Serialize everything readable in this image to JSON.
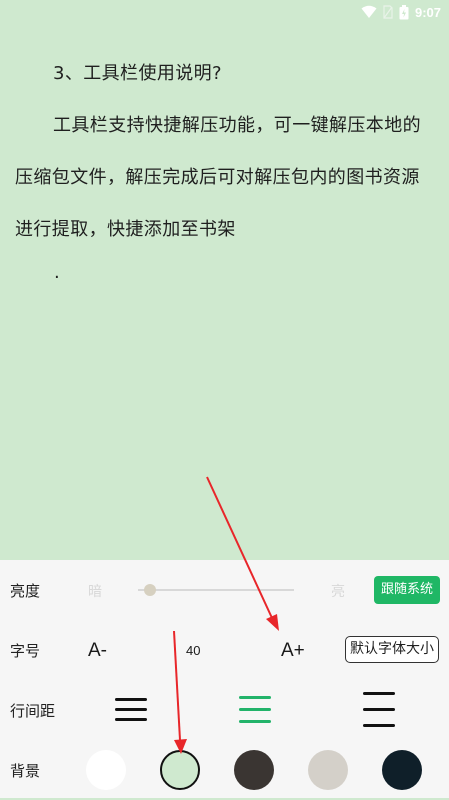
{
  "status_bar": {
    "time": "9:07",
    "icons": [
      "wifi-icon",
      "no-sim-icon",
      "battery-icon"
    ]
  },
  "content": {
    "heading": "3、工具栏使用说明?",
    "paragraph": "工具栏支持快捷解压功能，可一键解压本地的压缩包文件，解压完成后可对解压包内的图书资源进行提取，快捷添加至书架",
    "trailing": "."
  },
  "settings": {
    "brightness": {
      "label": "亮度",
      "dark_label": "暗",
      "light_label": "亮",
      "follow_system": "跟随系统",
      "level": 0.08
    },
    "font": {
      "label": "字号",
      "decrease": "A-",
      "value": "40",
      "increase": "A+",
      "default_size": "默认字体大小"
    },
    "line_spacing": {
      "label": "行间距",
      "options": [
        "compact",
        "medium",
        "loose"
      ],
      "selected": "medium"
    },
    "background": {
      "label": "背景",
      "colors": [
        "#ffffff",
        "#cfe9cf",
        "#3a3532",
        "#d4d0c9",
        "#0f1f29"
      ],
      "selected_index": 1
    },
    "accent_color": "#1fb765"
  }
}
